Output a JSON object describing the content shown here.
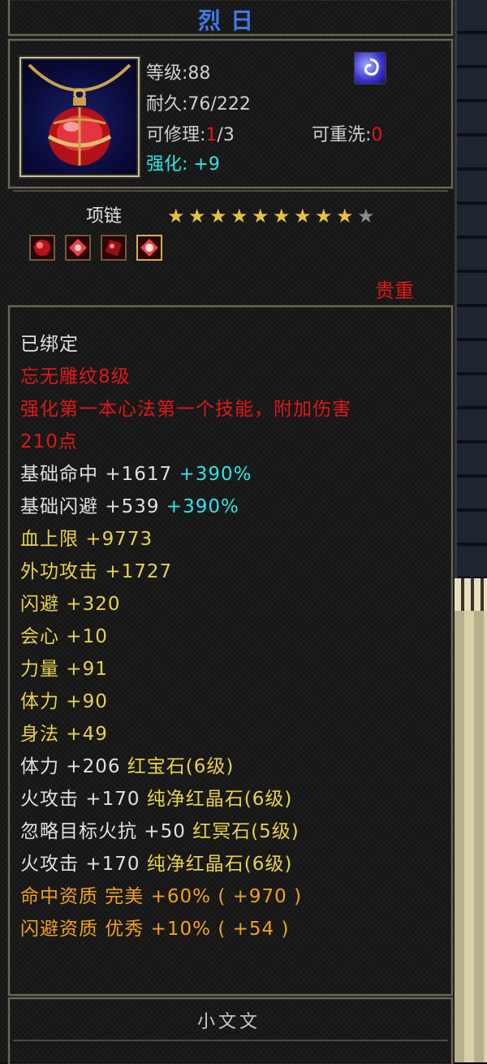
{
  "item": {
    "name": "烈日",
    "level": "等级:88",
    "durability": "耐久:76/222",
    "repair_label": "可修理:",
    "repair_value": "1",
    "repair_total": "/3",
    "rewash_label": "可重洗:",
    "rewash_value": "0",
    "enhance_label": "强化:",
    "enhance_value": "+9",
    "type": "项链",
    "stars_filled": 9,
    "stars_total": 10,
    "rarity": "贵重",
    "icon": "ruby-pendant-necklace-icon",
    "badge_icon": "swirl-spell-icon"
  },
  "attributes": {
    "bound": "已绑定",
    "engraving": "忘无雕纹8级",
    "effect_line1": "强化第一本心法第一个技能，附加伤害",
    "effect_line2": "210点",
    "hit_label": "基础命中",
    "hit_value": "+1617",
    "hit_pct": "+390%",
    "dodge_label": "基础闪避",
    "dodge_value": "+539",
    "dodge_pct": "+390%",
    "hp": "血上限  +9773",
    "atk": "外功攻击  +1727",
    "evade": "闪避  +320",
    "crit": "会心  +10",
    "str": "力量  +91",
    "con": "体力  +90",
    "agi": "身法  +49",
    "gem1_stat": "体力  +206",
    "gem1_name": "红宝石(6级)",
    "gem2_stat": "火攻击  +170",
    "gem2_name": "纯净红晶石(6级)",
    "gem3_stat": "忽略目标火抗  +50",
    "gem3_name": "红冥石(5级)",
    "gem4_stat": "火攻击  +170",
    "gem4_name": "纯净红晶石(6级)",
    "apt1": "命中资质   完美  +60% ( +970 )",
    "apt2": "闪避资质   优秀  +10% ( +54 )"
  },
  "footer": {
    "title": "小文文"
  }
}
